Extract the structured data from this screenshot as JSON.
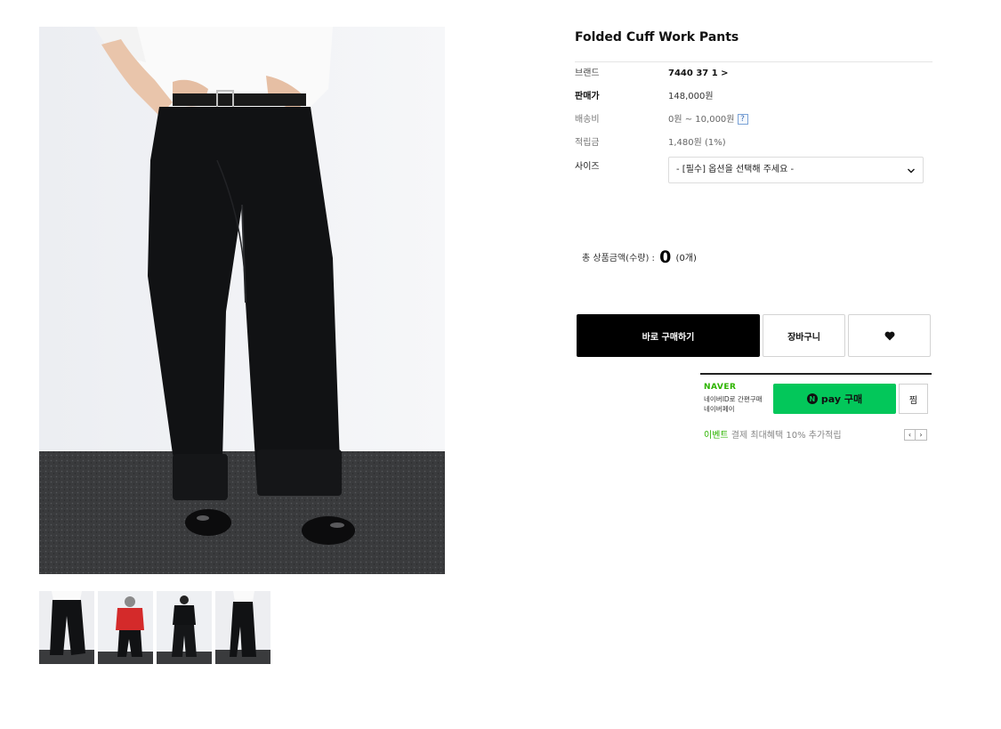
{
  "product": {
    "title": "Folded Cuff Work Pants",
    "specs": [
      {
        "label": "브랜드",
        "value": "7440 37 1 >"
      },
      {
        "label": "판매가",
        "value": "148,000원"
      },
      {
        "label": "배송비",
        "value": "0원 ~ 10,000원",
        "help": "?"
      },
      {
        "label": "적립금",
        "value": "1,480원 (1%)"
      }
    ],
    "size": {
      "label": "사이즈",
      "selected": "- [필수] 옵션을 선택해 주세요 -"
    }
  },
  "total": {
    "label": "총 상품금액(수량) :",
    "amount": "0",
    "count": "(0개)"
  },
  "actions": {
    "buy": "바로 구매하기",
    "cart": "장바구니",
    "wish_icon": "heart-icon"
  },
  "naver_pay": {
    "brand": "NAVER",
    "line1": "네이버ID로 간편구매",
    "line2": "네이버페이",
    "badge": "N",
    "pay_label": "pay 구매",
    "zzim": "찜",
    "event_tag": "이벤트",
    "event_text": "결제 최대혜택 10% 추가적립",
    "prev": "‹",
    "next": "›"
  },
  "thumbnails": [
    "black-pants-front",
    "red-sweater-outfit",
    "black-outfit-back",
    "black-pants-side"
  ],
  "colors": {
    "accent": "#000000",
    "naver_green": "#03c75a",
    "naver_text": "#2db400"
  }
}
